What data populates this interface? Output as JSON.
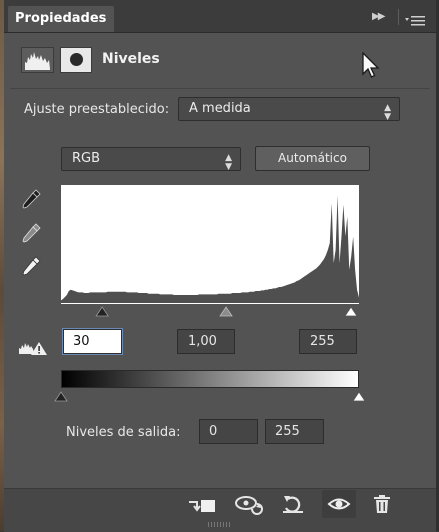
{
  "panel": {
    "tab_label": "Propiedades",
    "title": "Niveles"
  },
  "preset": {
    "label": "Ajuste preestablecido:",
    "value": "A medida"
  },
  "channel": {
    "value": "RGB",
    "auto_label": "Automático"
  },
  "input_levels": {
    "black": "30",
    "gamma": "1,00",
    "white": "255",
    "black_slider": 30,
    "gamma_slider": 142,
    "white_slider": 255
  },
  "output_levels": {
    "label": "Niveles de salida:",
    "black": "0",
    "white": "255",
    "black_slider": 0,
    "white_slider": 255
  },
  "histogram": {
    "samples": [
      4,
      6,
      9,
      12,
      18,
      20,
      19,
      18,
      17,
      16,
      16,
      16,
      15,
      15,
      15,
      16,
      16,
      16,
      16,
      16,
      16,
      16,
      16,
      16,
      17,
      17,
      17,
      17,
      17,
      17,
      17,
      17,
      17,
      17,
      16,
      16,
      16,
      16,
      16,
      16,
      15,
      15,
      15,
      15,
      15,
      14,
      14,
      14,
      14,
      14,
      14,
      13,
      13,
      13,
      13,
      13,
      13,
      13,
      12,
      12,
      12,
      12,
      12,
      12,
      12,
      12,
      12,
      12,
      12,
      12,
      12,
      13,
      13,
      13,
      13,
      13,
      13,
      13,
      13,
      13,
      13,
      14,
      14,
      14,
      14,
      14,
      14,
      14,
      15,
      15,
      15,
      15,
      15,
      16,
      16,
      16,
      16,
      17,
      17,
      17,
      18,
      18,
      18,
      19,
      19,
      20,
      20,
      21,
      21,
      22,
      22,
      23,
      24,
      24,
      25,
      26,
      27,
      28,
      29,
      30,
      31,
      33,
      34,
      36,
      38,
      40,
      42,
      44,
      46,
      48,
      50,
      52,
      55,
      58,
      62,
      66,
      72,
      80,
      90,
      150,
      60,
      80,
      162,
      60,
      100,
      148,
      100,
      130,
      50,
      70,
      100,
      50,
      20,
      8
    ],
    "colors": {
      "bg": "#ffffff",
      "fill": "#4f4f4f"
    }
  },
  "icons": {
    "eyedroppers": [
      "eyedropper-black-icon",
      "eyedropper-gray-icon",
      "eyedropper-white-icon"
    ],
    "bottom": [
      "clip-to-layer-icon",
      "view-previous-state-icon",
      "reset-icon",
      "visibility-eye-icon",
      "trash-icon"
    ]
  },
  "colors": {
    "panel": "#535353",
    "tabbar": "#3c3c3c",
    "text": "#e8e8e8"
  }
}
